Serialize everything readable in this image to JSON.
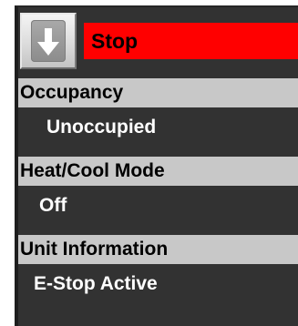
{
  "status": {
    "label": "Stop",
    "color": "#ff0000"
  },
  "down_button": {
    "icon": "arrow-down-icon"
  },
  "sections": [
    {
      "header": "Occupancy",
      "value": "Unoccupied"
    },
    {
      "header": "Heat/Cool Mode",
      "value": "Off"
    },
    {
      "header": "Unit Information",
      "value": "E-Stop Active"
    }
  ],
  "colors": {
    "panel_background": "#323232",
    "header_background": "#c8c8c8",
    "value_text": "#ffffff",
    "status_background": "#ff0000"
  }
}
